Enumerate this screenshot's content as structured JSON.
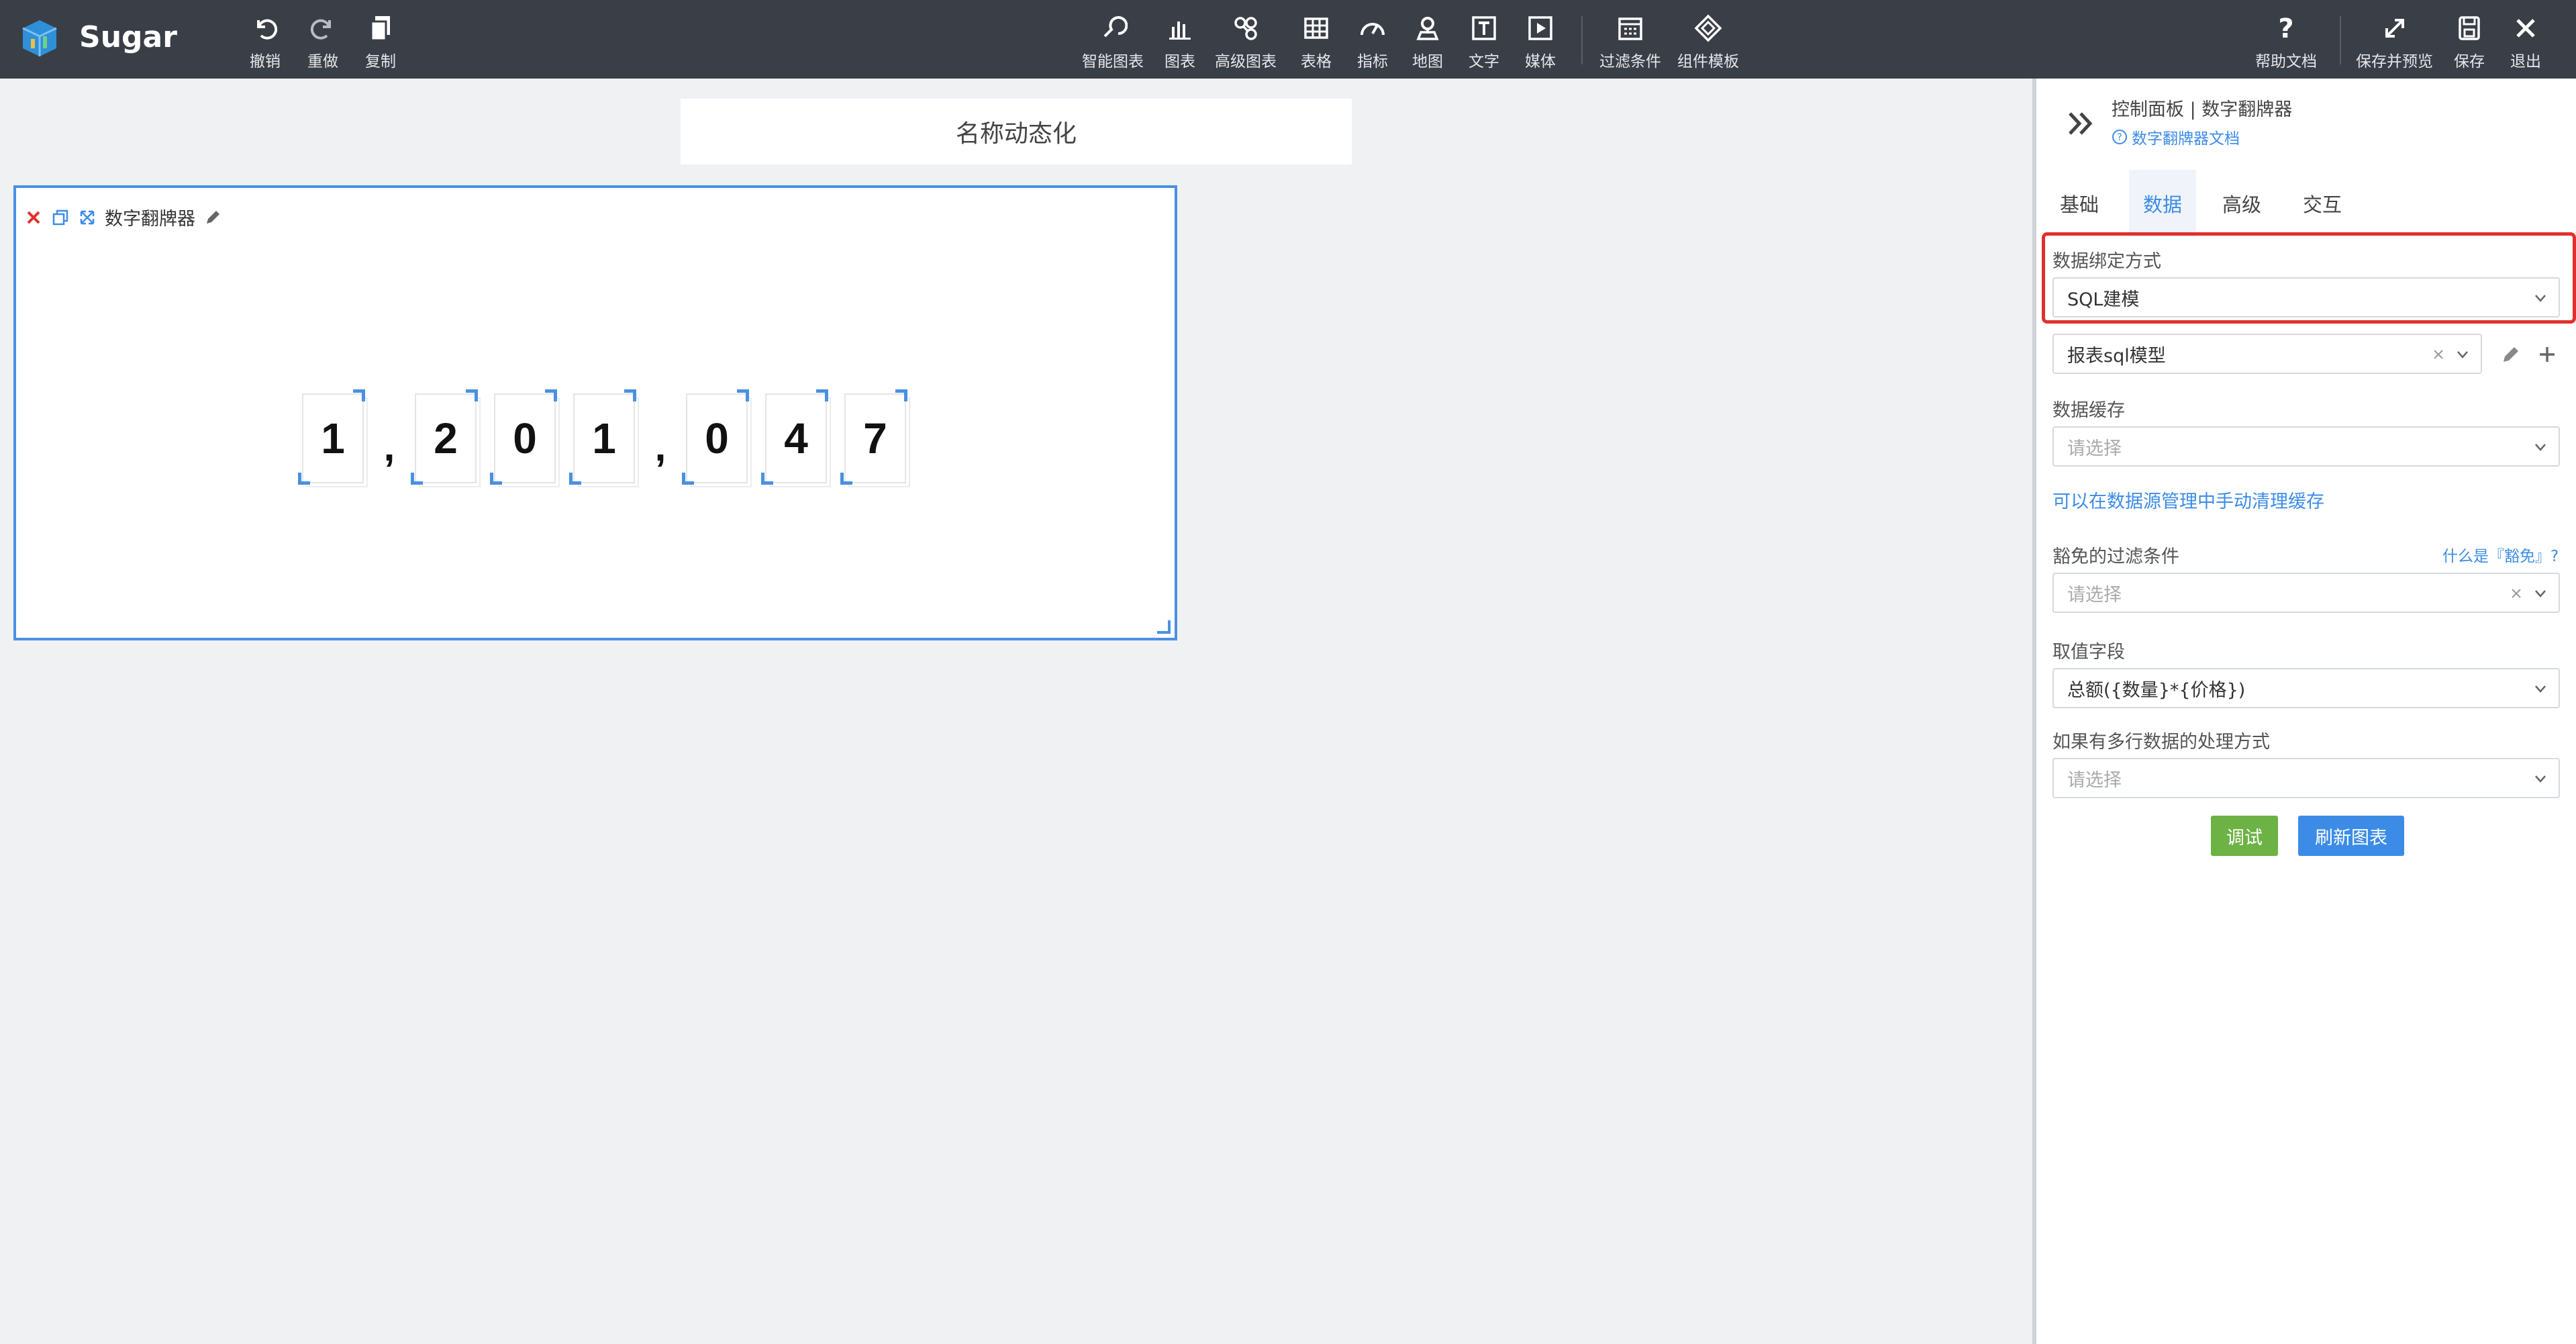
{
  "app": {
    "name": "Sugar"
  },
  "toolbar": {
    "undo": "撤销",
    "redo": "重做",
    "copy": "复制",
    "smart_chart": "智能图表",
    "chart": "图表",
    "advanced_chart": "高级图表",
    "table": "表格",
    "metric": "指标",
    "map": "地图",
    "text": "文字",
    "media": "媒体",
    "filter": "过滤条件",
    "component_template": "组件模板",
    "help_doc": "帮助文档",
    "save_preview": "保存并预览",
    "save": "保存",
    "exit": "退出"
  },
  "canvas": {
    "title": "名称动态化",
    "widget": {
      "name": "数字翻牌器",
      "digits": [
        "1",
        ",",
        "2",
        "0",
        "1",
        ",",
        "0",
        "4",
        "7"
      ]
    }
  },
  "panel": {
    "breadcrumb": "控制面板 | 数字翻牌器",
    "doc_link": "数字翻牌器文档",
    "tabs": [
      "基础",
      "数据",
      "高级",
      "交互"
    ],
    "active_tab": "数据",
    "binding_label": "数据绑定方式",
    "binding_value": "SQL建模",
    "model_value": "报表sql模型",
    "cache_label": "数据缓存",
    "cache_placeholder": "请选择",
    "cache_hint": "可以在数据源管理中手动清理缓存",
    "exempt_label": "豁免的过滤条件",
    "exempt_help": "什么是『豁免』?",
    "exempt_placeholder": "请选择",
    "value_field_label": "取值字段",
    "value_field_value": "总额({数量}*{价格})",
    "multi_row_label": "如果有多行数据的处理方式",
    "multi_row_placeholder": "请选择",
    "debug_button": "调试",
    "refresh_button": "刷新图表"
  }
}
